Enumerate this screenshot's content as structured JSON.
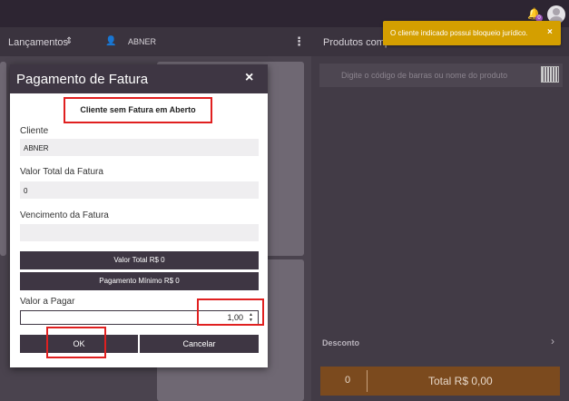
{
  "header": {
    "notification_badge": "0"
  },
  "subbar": {
    "lancamentos_label": "Lançamentos",
    "user_name": "ABNER",
    "produtos_label": "Produtos comp"
  },
  "right_panel": {
    "barcode_placeholder": "Digite o código de barras ou nome do produto",
    "desconto_label": "Desconto",
    "total_count": "0",
    "total_value": "Total R$ 0,00"
  },
  "toast": {
    "message": "O cliente indicado possui bloqueio jurídico.",
    "close": "×"
  },
  "modal": {
    "title": "Pagamento de Fatura",
    "close": "×",
    "notice": "Cliente sem Fatura em Aberto",
    "cliente_label": "Cliente",
    "cliente_value": "ABNER",
    "valor_total_label": "Valor Total da Fatura",
    "valor_total_value": "0",
    "vencimento_label": "Vencimento da Fatura",
    "vencimento_value": "",
    "valor_total_button": "Valor Total R$ 0",
    "pagamento_minimo_button": "Pagamento Mínimo R$ 0",
    "valor_pagar_label": "Valor a Pagar",
    "valor_pagar_value": "1,00",
    "ok_button": "OK",
    "cancelar_button": "Cancelar"
  },
  "colors": {
    "header": "#3e3643",
    "toast": "#d49f00",
    "highlight": "#e02020",
    "total_bar": "#7b4a1e"
  }
}
